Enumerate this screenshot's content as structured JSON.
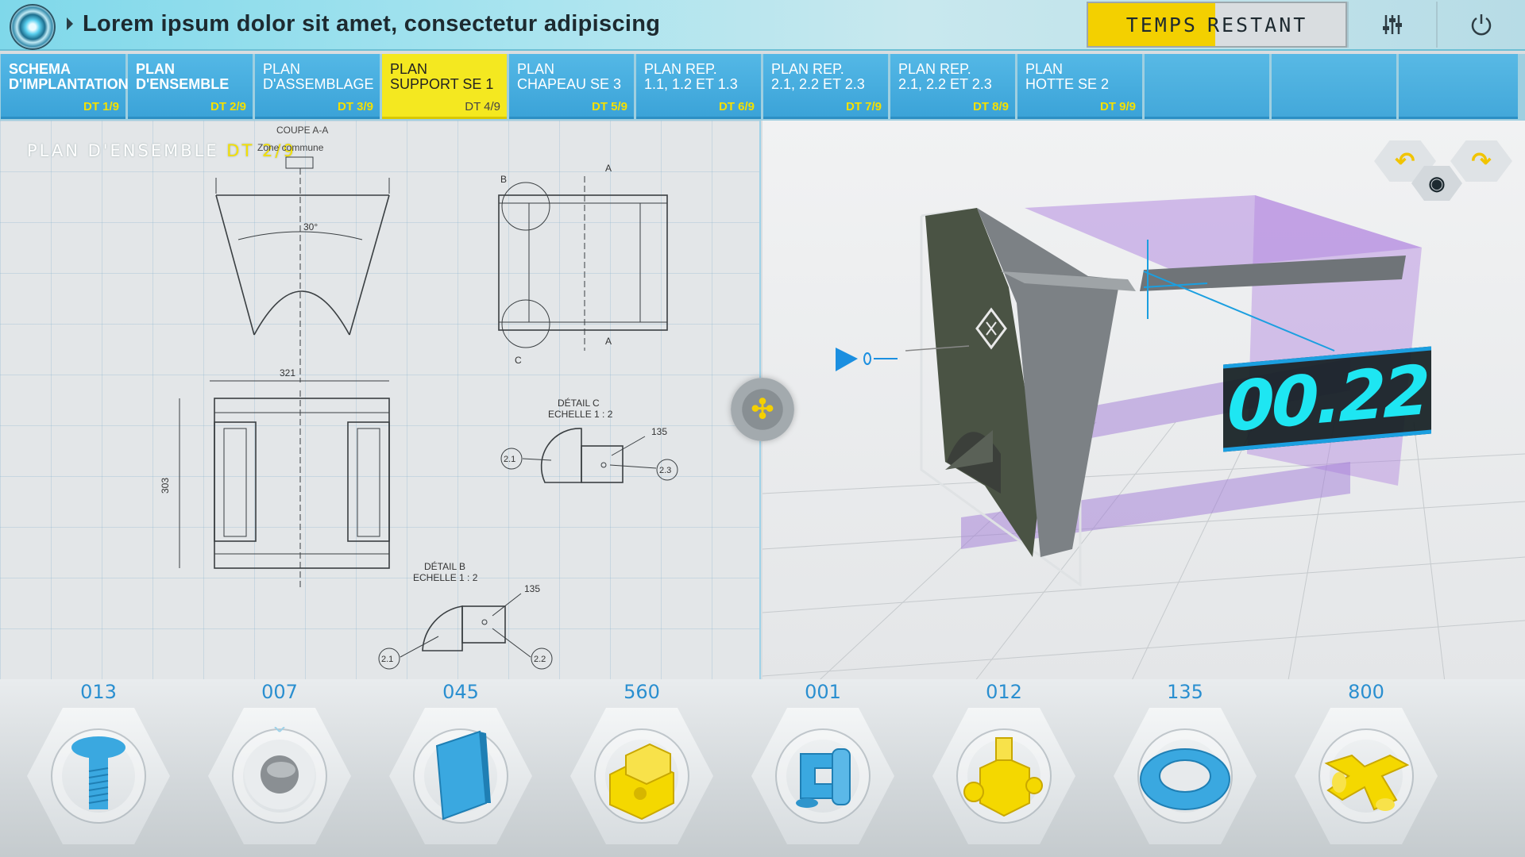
{
  "header": {
    "title": "Lorem ipsum dolor sit amet, consectetur adipiscing",
    "timer_label_1": "TEMPS",
    "timer_label_2": "RESTANT"
  },
  "tabs": [
    {
      "label": "SCHEMA\nD'IMPLANTATION",
      "code": "DT 1/9",
      "active": false
    },
    {
      "label": "PLAN\nD'ENSEMBLE",
      "code": "DT 2/9",
      "active": false
    },
    {
      "label": "PLAN\nD'ASSEMBLAGE",
      "code": "DT 3/9",
      "active": false
    },
    {
      "label": "PLAN\nSUPPORT SE 1",
      "code": "DT 4/9",
      "active": true
    },
    {
      "label": "PLAN\nCHAPEAU SE 3",
      "code": "DT 5/9",
      "active": false
    },
    {
      "label": "PLAN REP.\n1.1, 1.2 ET 1.3",
      "code": "DT 6/9",
      "active": false
    },
    {
      "label": "PLAN REP.\n2.1, 2.2 ET 2.3",
      "code": "DT 7/9",
      "active": false
    },
    {
      "label": "PLAN REP.\n2.1, 2.2 ET 2.3",
      "code": "DT 8/9",
      "active": false
    },
    {
      "label": "PLAN\nHOTTE SE 2",
      "code": "DT 9/9",
      "active": false
    }
  ],
  "blueprint": {
    "title": "PLAN D'ENSEMBLE",
    "title_code": "DT 2/9",
    "labels": {
      "coupe": "COUPE A-A",
      "zone": "Zone commune",
      "angle": "30°",
      "width": "321",
      "height": "303",
      "detail_c": "DÉTAIL C",
      "detail_c_scale": "ECHELLE 1 : 2",
      "detail_b": "DÉTAIL B",
      "detail_b_scale": "ECHELLE 1 : 2",
      "dim_135": "135",
      "ref_21": "2.1",
      "ref_22": "2.2",
      "ref_23": "2.3",
      "mark_a": "A",
      "mark_b": "B",
      "mark_c": "C"
    }
  },
  "viewer": {
    "readout": "00.22"
  },
  "parts": [
    {
      "count": "013",
      "icon": "bolt-icon",
      "color": "#3aa8e0"
    },
    {
      "count": "007",
      "icon": "sleeve-icon",
      "color": "#8a8f93"
    },
    {
      "count": "045",
      "icon": "panel-icon",
      "color": "#3aa8e0"
    },
    {
      "count": "560",
      "icon": "block-icon",
      "color": "#f4d800"
    },
    {
      "count": "001",
      "icon": "clip-icon",
      "color": "#3aa8e0"
    },
    {
      "count": "012",
      "icon": "fitting-icon",
      "color": "#f4d800"
    },
    {
      "count": "135",
      "icon": "ring-icon",
      "color": "#3aa8e0"
    },
    {
      "count": "800",
      "icon": "cross-icon",
      "color": "#f4d800"
    }
  ]
}
